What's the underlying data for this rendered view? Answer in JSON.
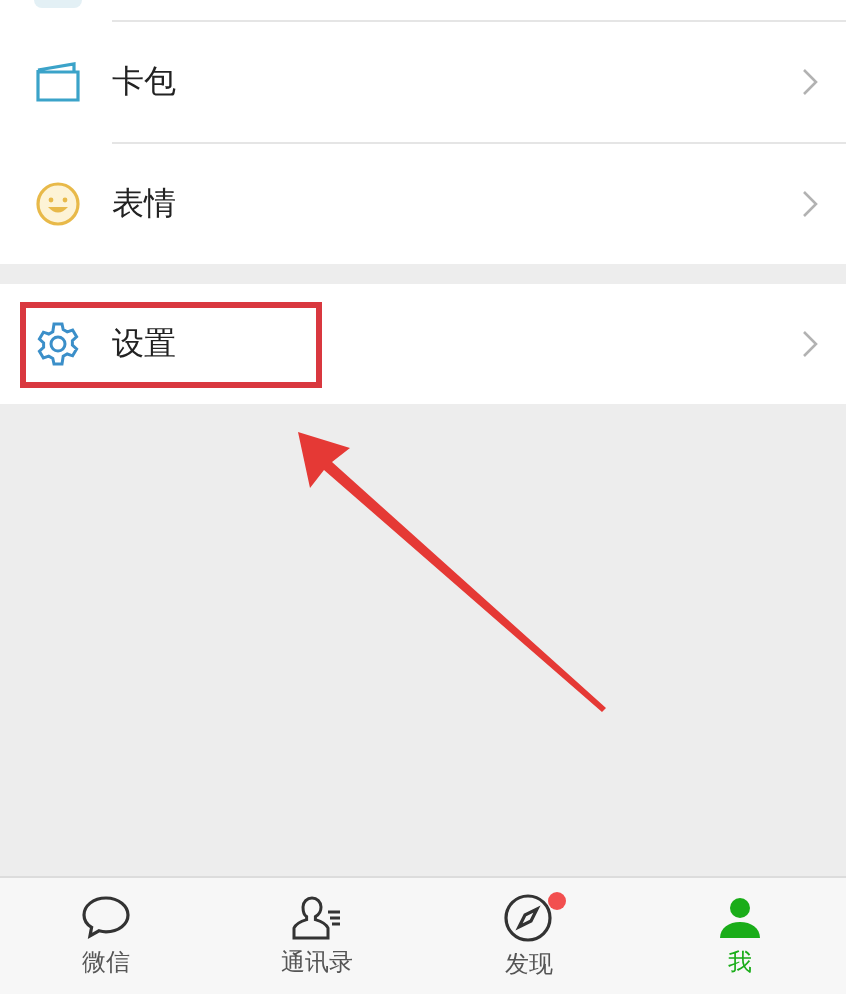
{
  "menu": [
    {
      "kind": "card",
      "label": "卡包",
      "highlighted": false
    },
    {
      "kind": "emoji",
      "label": "表情",
      "highlighted": false
    },
    {
      "kind": "settings",
      "label": "设置",
      "highlighted": true
    }
  ],
  "tab_bar": [
    {
      "kind": "chat",
      "label": "微信",
      "selected": false,
      "badge": false
    },
    {
      "kind": "contacts",
      "label": "通讯录",
      "selected": false,
      "badge": false
    },
    {
      "kind": "discover",
      "label": "发现",
      "selected": false,
      "badge": true
    },
    {
      "kind": "me",
      "label": "我",
      "selected": true,
      "badge": false
    }
  ]
}
